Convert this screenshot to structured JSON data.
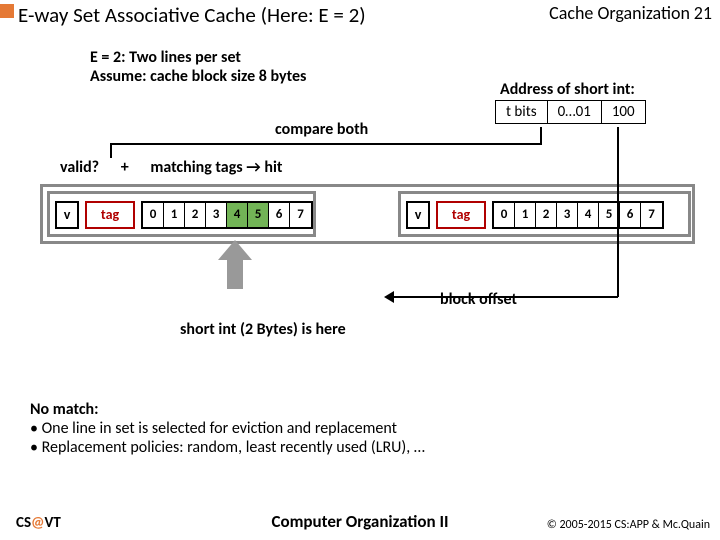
{
  "header": {
    "title": "E-way Set Associative Cache (Here: E = 2)",
    "topic": "Cache Organization",
    "page": "21"
  },
  "subtitle": {
    "l1": "E = 2: Two lines per set",
    "l2": "Assume: cache block size 8 bytes"
  },
  "address": {
    "label": "Address of short int:",
    "f1": "t bits",
    "f2": "0…01",
    "f3": "100"
  },
  "compare": "compare both",
  "question": {
    "valid": "valid?",
    "plus": "+",
    "match": "matching tags → hit"
  },
  "line": {
    "v": "v",
    "tag": "tag",
    "b0": "0",
    "b1": "1",
    "b2": "2",
    "b3": "3",
    "b4": "4",
    "b5": "5",
    "b6": "6",
    "b7": "7"
  },
  "offset_label": "block offset",
  "shortint": "short int (2 Bytes) is here",
  "nomatch": {
    "hd": "No match:",
    "l1": "• One line in set is selected for eviction and replacement",
    "l2": "• Replacement policies: random, least recently used (LRU), …"
  },
  "footer": {
    "left_a": "CS",
    "left_at": "@",
    "left_b": "VT",
    "center": "Computer Organization II",
    "right": "© 2005-2015 CS:APP & Mc.Quain"
  }
}
